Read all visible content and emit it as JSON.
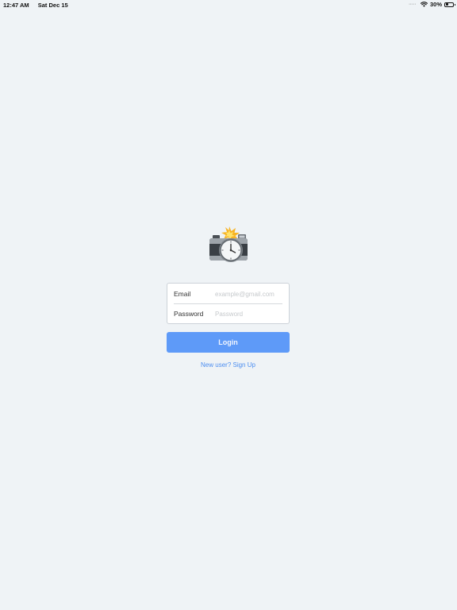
{
  "status_bar": {
    "time": "12:47 AM",
    "date": "Sat Dec 15",
    "battery_percent_label": "30%",
    "battery_level": 0.3,
    "signal_dots": "·····"
  },
  "logo": {
    "icon": "camera-with-timer-icon"
  },
  "login_form": {
    "email_label": "Email",
    "email_placeholder": "example@gmail.com",
    "email_value": "",
    "password_label": "Password",
    "password_placeholder": "Password",
    "password_value": ""
  },
  "login_button": {
    "label": "Login"
  },
  "signup_link": {
    "label": "New user? Sign Up"
  },
  "colors": {
    "background": "#eff3f6",
    "button": "#5e9af8",
    "link": "#4c8ef0"
  }
}
